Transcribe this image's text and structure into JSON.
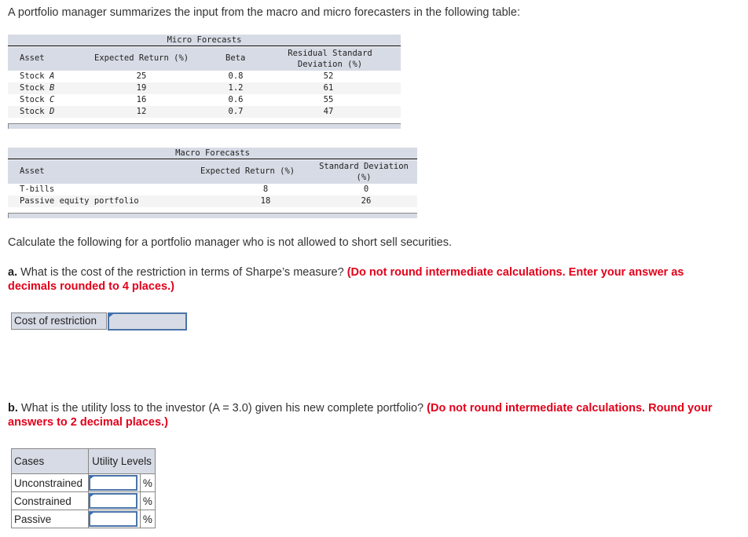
{
  "intro": "A portfolio manager summarizes the input from the macro and micro forecasters in the following table:",
  "micro": {
    "caption": "Micro Forecasts",
    "headers": {
      "asset": "Asset",
      "expected_return": "Expected Return (%)",
      "beta": "Beta",
      "residual_sd_line1": "Residual Standard",
      "residual_sd_line2": "Deviation (%)"
    },
    "rows": [
      {
        "prefix": "Stock ",
        "letter": "A",
        "expected_return": "25",
        "beta": "0.8",
        "residual_sd": "52"
      },
      {
        "prefix": "Stock ",
        "letter": "B",
        "expected_return": "19",
        "beta": "1.2",
        "residual_sd": "61"
      },
      {
        "prefix": "Stock ",
        "letter": "C",
        "expected_return": "16",
        "beta": "0.6",
        "residual_sd": "55"
      },
      {
        "prefix": "Stock ",
        "letter": "D",
        "expected_return": "12",
        "beta": "0.7",
        "residual_sd": "47"
      }
    ]
  },
  "macro": {
    "caption": "Macro Forecasts",
    "headers": {
      "asset": "Asset",
      "expected_return": "Expected Return (%)",
      "sd_line1": "Standard Deviation",
      "sd_line2": "(%)"
    },
    "rows": [
      {
        "asset": "T-bills",
        "expected_return": "8",
        "sd": "0"
      },
      {
        "asset": "Passive equity portfolio",
        "expected_return": "18",
        "sd": "26"
      }
    ]
  },
  "instruction": "Calculate the following for a portfolio manager who is not allowed to short sell securities.",
  "part_a": {
    "label": "a.",
    "question": " What is the cost of the restriction in terms of Sharpe’s measure? ",
    "note": "(Do not round intermediate calculations. Enter your answer as decimals rounded to 4 places.)",
    "field_label": "Cost of restriction",
    "field_value": ""
  },
  "part_b": {
    "label": "b.",
    "question": " What is the utility loss to the investor (A = 3.0) given his new complete portfolio? ",
    "note": "(Do not round intermediate calculations. Round your answers to 2 decimal places.)",
    "headers": {
      "cases": "Cases",
      "utility": "Utility Levels"
    },
    "rows": [
      {
        "case": "Unconstrained",
        "value": "",
        "unit": "%"
      },
      {
        "case": "Constrained",
        "value": "",
        "unit": "%"
      },
      {
        "case": "Passive",
        "value": "",
        "unit": "%"
      }
    ]
  }
}
